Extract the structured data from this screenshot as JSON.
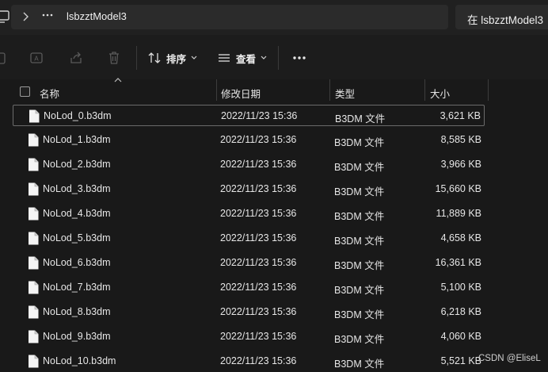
{
  "address": {
    "more_crumb_label": "…",
    "folder": "lsbzztModel3",
    "search_placeholder": "在 lsbzztModel3"
  },
  "toolbar": {
    "sort_label": "排序",
    "view_label": "查看",
    "more_label": "•••"
  },
  "columns": {
    "name": "名称",
    "date": "修改日期",
    "type": "类型",
    "size": "大小"
  },
  "files": [
    {
      "name": "NoLod_0.b3dm",
      "date": "2022/11/23 15:36",
      "type": "B3DM 文件",
      "size": "3,621 KB",
      "selected": true
    },
    {
      "name": "NoLod_1.b3dm",
      "date": "2022/11/23 15:36",
      "type": "B3DM 文件",
      "size": "8,585 KB"
    },
    {
      "name": "NoLod_2.b3dm",
      "date": "2022/11/23 15:36",
      "type": "B3DM 文件",
      "size": "3,966 KB"
    },
    {
      "name": "NoLod_3.b3dm",
      "date": "2022/11/23 15:36",
      "type": "B3DM 文件",
      "size": "15,660 KB"
    },
    {
      "name": "NoLod_4.b3dm",
      "date": "2022/11/23 15:36",
      "type": "B3DM 文件",
      "size": "11,889 KB"
    },
    {
      "name": "NoLod_5.b3dm",
      "date": "2022/11/23 15:36",
      "type": "B3DM 文件",
      "size": "4,658 KB"
    },
    {
      "name": "NoLod_6.b3dm",
      "date": "2022/11/23 15:36",
      "type": "B3DM 文件",
      "size": "16,361 KB"
    },
    {
      "name": "NoLod_7.b3dm",
      "date": "2022/11/23 15:36",
      "type": "B3DM 文件",
      "size": "5,100 KB"
    },
    {
      "name": "NoLod_8.b3dm",
      "date": "2022/11/23 15:36",
      "type": "B3DM 文件",
      "size": "6,218 KB"
    },
    {
      "name": "NoLod_9.b3dm",
      "date": "2022/11/23 15:36",
      "type": "B3DM 文件",
      "size": "4,060 KB"
    },
    {
      "name": "NoLod_10.b3dm",
      "date": "2022/11/23 15:36",
      "type": "B3DM 文件",
      "size": "5,521 KB"
    }
  ],
  "watermark": "CSDN @EliseL",
  "colors": {
    "background": "#191919",
    "toolbar": "#1c1c1c",
    "text": "#e6e6e6",
    "selection_border": "#6b6b6b"
  }
}
